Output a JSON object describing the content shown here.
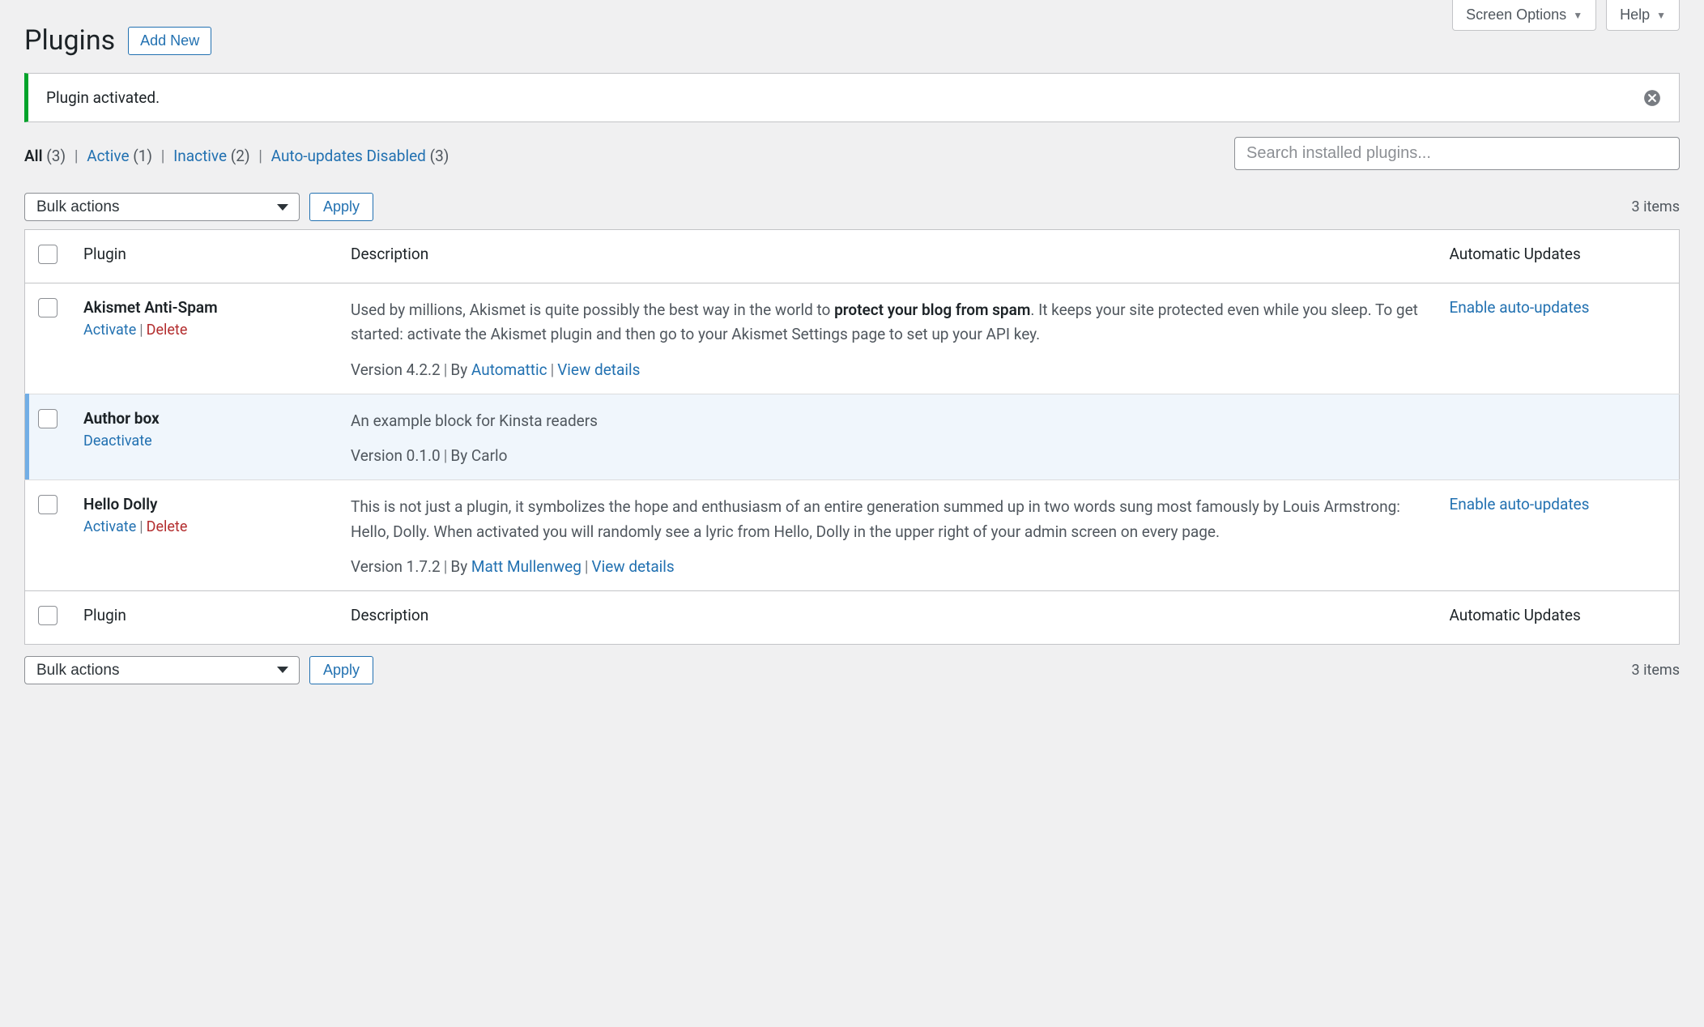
{
  "top": {
    "screen_options": "Screen Options",
    "help": "Help"
  },
  "header": {
    "title": "Plugins",
    "add_new": "Add New"
  },
  "notice": {
    "message": "Plugin activated."
  },
  "filters": {
    "all_label": "All",
    "all_count": "(3)",
    "active_label": "Active",
    "active_count": "(1)",
    "inactive_label": "Inactive",
    "inactive_count": "(2)",
    "autoupdates_label": "Auto-updates Disabled",
    "autoupdates_count": "(3)"
  },
  "search": {
    "placeholder": "Search installed plugins..."
  },
  "bulk": {
    "select_label": "Bulk actions",
    "apply": "Apply"
  },
  "items_count": "3 items",
  "columns": {
    "plugin": "Plugin",
    "description": "Description",
    "auto_updates": "Automatic Updates"
  },
  "actions": {
    "activate": "Activate",
    "deactivate": "Deactivate",
    "delete": "Delete",
    "enable_auto": "Enable auto-updates",
    "view_details": "View details",
    "by": "By"
  },
  "plugins": [
    {
      "name": "Akismet Anti-Spam",
      "active": false,
      "desc_pre": "Used by millions, Akismet is quite possibly the best way in the world to ",
      "desc_strong": "protect your blog from spam",
      "desc_post": ". It keeps your site protected even while you sleep. To get started: activate the Akismet plugin and then go to your Akismet Settings page to set up your API key.",
      "version": "Version 4.2.2",
      "author": "Automattic",
      "author_link": true,
      "has_details": true,
      "has_auto": true
    },
    {
      "name": "Author box",
      "active": true,
      "desc_pre": "An example block for Kinsta readers",
      "desc_strong": "",
      "desc_post": "",
      "version": "Version 0.1.0",
      "author": "Carlo",
      "author_link": false,
      "has_details": false,
      "has_auto": false
    },
    {
      "name": "Hello Dolly",
      "active": false,
      "desc_pre": "This is not just a plugin, it symbolizes the hope and enthusiasm of an entire generation summed up in two words sung most famously by Louis Armstrong: Hello, Dolly. When activated you will randomly see a lyric from Hello, Dolly in the upper right of your admin screen on every page.",
      "desc_strong": "",
      "desc_post": "",
      "version": "Version 1.7.2",
      "author": "Matt Mullenweg",
      "author_link": true,
      "has_details": true,
      "has_auto": true
    }
  ]
}
